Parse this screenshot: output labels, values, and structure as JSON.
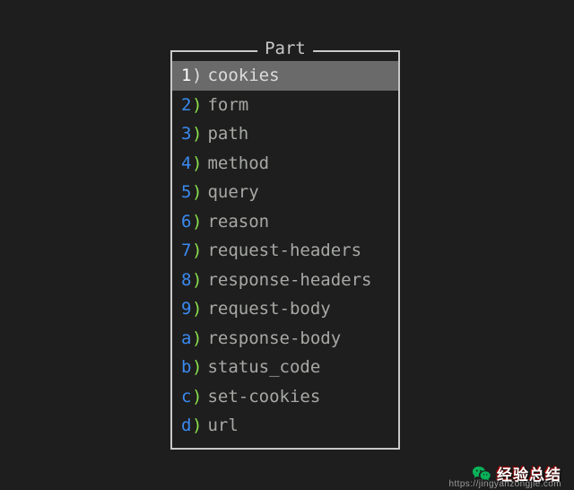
{
  "panel": {
    "title": "Part",
    "items": [
      {
        "key": "1",
        "label": "cookies",
        "selected": true
      },
      {
        "key": "2",
        "label": "form",
        "selected": false
      },
      {
        "key": "3",
        "label": "path",
        "selected": false
      },
      {
        "key": "4",
        "label": "method",
        "selected": false
      },
      {
        "key": "5",
        "label": "query",
        "selected": false
      },
      {
        "key": "6",
        "label": "reason",
        "selected": false
      },
      {
        "key": "7",
        "label": "request-headers",
        "selected": false
      },
      {
        "key": "8",
        "label": "response-headers",
        "selected": false
      },
      {
        "key": "9",
        "label": "request-body",
        "selected": false
      },
      {
        "key": "a",
        "label": "response-body",
        "selected": false
      },
      {
        "key": "b",
        "label": "status_code",
        "selected": false
      },
      {
        "key": "c",
        "label": "set-cookies",
        "selected": false
      },
      {
        "key": "d",
        "label": "url",
        "selected": false
      }
    ]
  },
  "watermark": {
    "main": "经验总结",
    "sub": "jingyanzongjie.com",
    "prefix": "https://"
  }
}
